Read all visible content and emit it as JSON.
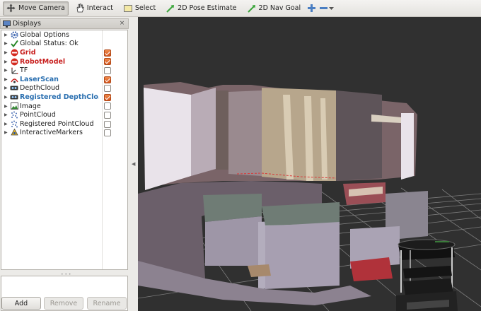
{
  "toolbar": {
    "tools": [
      {
        "label": "Move Camera",
        "icon": "move-camera-icon",
        "active": true
      },
      {
        "label": "Interact",
        "icon": "hand-icon",
        "active": false
      },
      {
        "label": "Select",
        "icon": "select-rect-icon",
        "active": false
      },
      {
        "label": "2D Pose Estimate",
        "icon": "green-arrow-icon",
        "active": false
      },
      {
        "label": "2D Nav Goal",
        "icon": "green-arrow-icon",
        "active": false
      }
    ]
  },
  "panel": {
    "title": "Displays",
    "close_label": "×",
    "displays": [
      {
        "label": "Global Options",
        "icon": "gear-icon",
        "style": "normal",
        "checkbox": null
      },
      {
        "label": "Global Status: Ok",
        "icon": "checkmark-icon",
        "style": "normal",
        "checkbox": null
      },
      {
        "label": "Grid",
        "icon": "error-icon",
        "style": "err",
        "checkbox": true
      },
      {
        "label": "RobotModel",
        "icon": "error-icon",
        "style": "err",
        "checkbox": true
      },
      {
        "label": "TF",
        "icon": "tf-icon",
        "style": "normal",
        "checkbox": false
      },
      {
        "label": "LaserScan",
        "icon": "laser-icon",
        "style": "hl",
        "checkbox": true
      },
      {
        "label": "DepthCloud",
        "icon": "camera-icon",
        "style": "normal",
        "checkbox": false
      },
      {
        "label": "Registered DepthClo...",
        "icon": "camera-icon",
        "style": "hl",
        "checkbox": true
      },
      {
        "label": "Image",
        "icon": "image-icon",
        "style": "normal",
        "checkbox": false
      },
      {
        "label": "PointCloud",
        "icon": "pointcloud-icon",
        "style": "normal",
        "checkbox": false
      },
      {
        "label": "Registered PointCloud",
        "icon": "pointcloud-icon",
        "style": "normal",
        "checkbox": false
      },
      {
        "label": "InteractiveMarkers",
        "icon": "markers-icon",
        "style": "normal",
        "checkbox": false
      }
    ],
    "buttons": {
      "add": "Add",
      "remove": "Remove",
      "rename": "Rename"
    }
  },
  "colors": {
    "error": "#c8201f",
    "highlight": "#2a6fb0",
    "checkbox_on": "#e06a2e",
    "view_bg": "#303030"
  }
}
